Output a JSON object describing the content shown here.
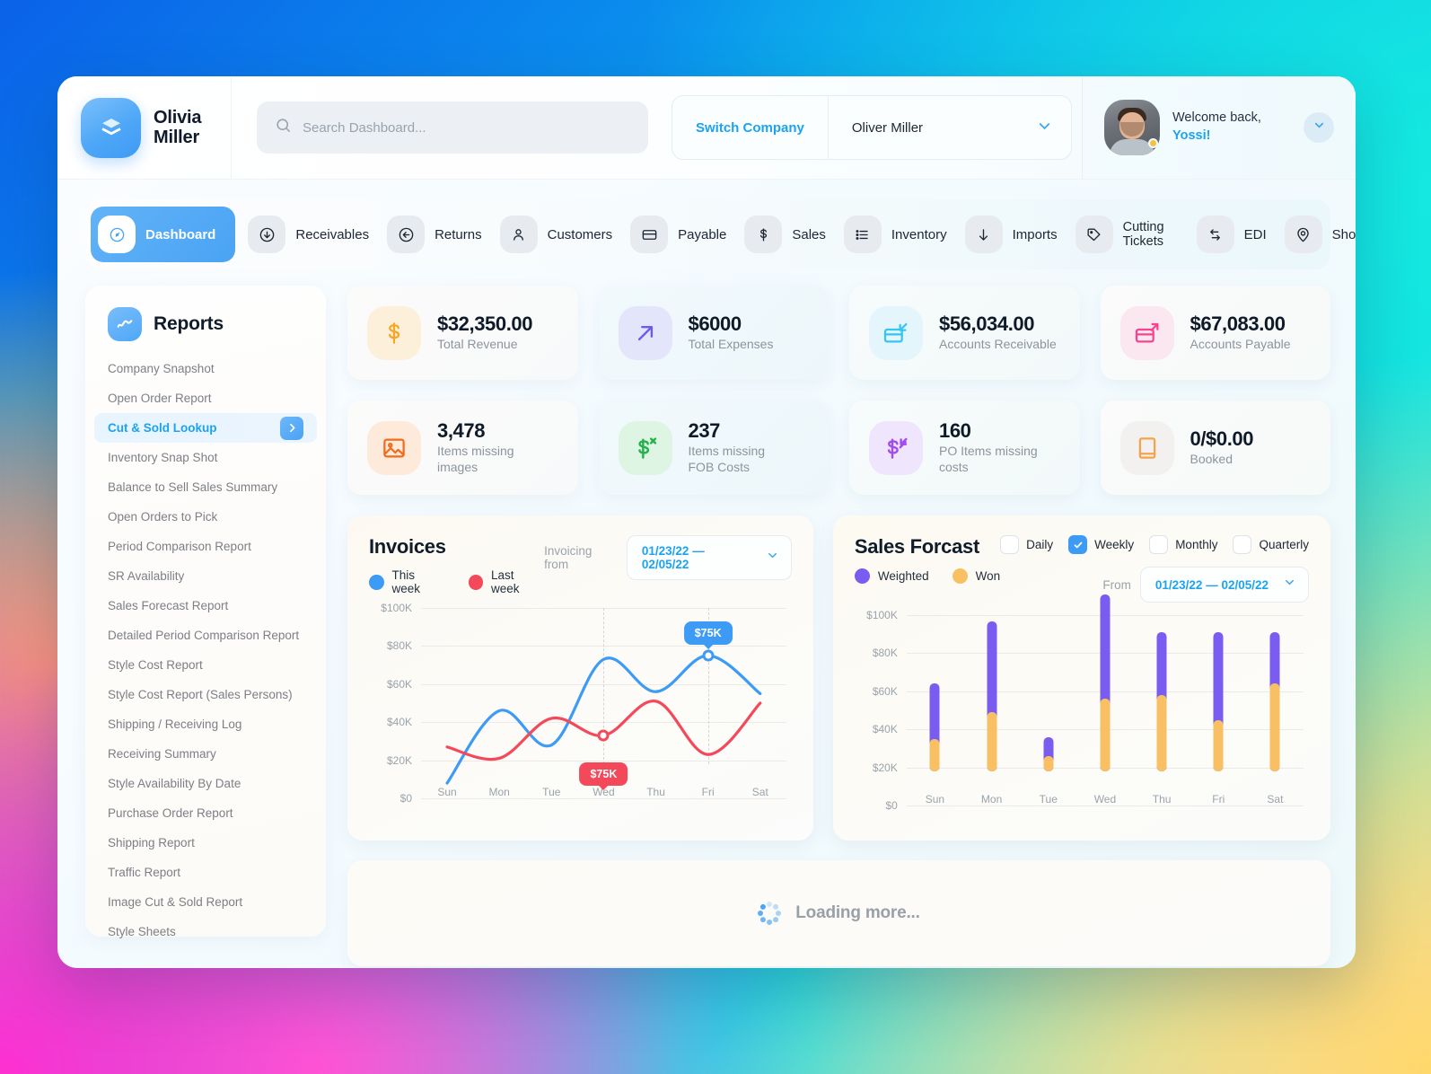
{
  "brand": {
    "name_line1": "Olivia",
    "name_line2": "Miller",
    "logo_icon": "layers-icon"
  },
  "search": {
    "placeholder": "Search Dashboard...",
    "value": "",
    "icon": "search-icon"
  },
  "switcher": {
    "switch_label": "Switch Company",
    "company": "Oliver Miller",
    "caret_icon": "chevron-down-icon"
  },
  "user": {
    "welcome": "Welcome back,",
    "name": "Yossi!",
    "avatar_icon": "avatar",
    "status": "away",
    "caret_icon": "chevron-down-icon"
  },
  "nav": {
    "items": [
      {
        "label": "Dashboard",
        "icon": "gauge-icon",
        "active": true
      },
      {
        "label": "Receivables",
        "icon": "arrow-down-circle-icon",
        "active": false
      },
      {
        "label": "Returns",
        "icon": "arrow-left-circle-icon",
        "active": false
      },
      {
        "label": "Customers",
        "icon": "user-icon",
        "active": false
      },
      {
        "label": "Payable",
        "icon": "card-icon",
        "active": false
      },
      {
        "label": "Sales",
        "icon": "dollar-icon",
        "active": false
      },
      {
        "label": "Inventory",
        "icon": "list-icon",
        "active": false
      },
      {
        "label": "Imports",
        "icon": "arrow-down-icon",
        "active": false
      },
      {
        "label": "Cutting Tickets",
        "icon": "tag-icon",
        "active": false,
        "two_line": true
      },
      {
        "label": "EDI",
        "icon": "transfer-icon",
        "active": false
      },
      {
        "label": "Showroom",
        "icon": "location-pin-icon",
        "active": false
      }
    ]
  },
  "sidebar": {
    "title": "Reports",
    "title_icon": "chart-line-icon",
    "arrow_icon": "chevron-right-icon",
    "items": [
      {
        "label": "Company Snapshot",
        "active": false
      },
      {
        "label": "Open Order Report",
        "active": false
      },
      {
        "label": "Cut & Sold Lookup",
        "active": true
      },
      {
        "label": "Inventory Snap Shot",
        "active": false
      },
      {
        "label": "Balance to Sell Sales Summary",
        "active": false
      },
      {
        "label": "Open Orders to Pick",
        "active": false
      },
      {
        "label": "Period Comparison Report",
        "active": false
      },
      {
        "label": "SR Availability",
        "active": false
      },
      {
        "label": "Sales Forecast Report",
        "active": false
      },
      {
        "label": "Detailed Period Comparison Report",
        "active": false
      },
      {
        "label": "Style Cost Report",
        "active": false
      },
      {
        "label": "Style Cost Report (Sales Persons)",
        "active": false
      },
      {
        "label": "Shipping / Receiving Log",
        "active": false
      },
      {
        "label": "Receiving Summary",
        "active": false
      },
      {
        "label": "Style Availability By Date",
        "active": false
      },
      {
        "label": "Purchase Order Report",
        "active": false
      },
      {
        "label": "Shipping Report",
        "active": false
      },
      {
        "label": "Traffic Report",
        "active": false
      },
      {
        "label": "Image Cut & Sold Report",
        "active": false
      },
      {
        "label": "Style Sheets",
        "active": false
      }
    ]
  },
  "kpis": [
    {
      "value": "$32,350.00",
      "label": "Total Revenue",
      "icon": "dollar-icon",
      "color": "#f5a623",
      "bg": "#fdf0da",
      "tone": "t1"
    },
    {
      "value": "$6000",
      "label": "Total Expenses",
      "icon": "arrow-up-right-icon",
      "color": "#6a5bf2",
      "bg": "#e3e6fb",
      "tone": "t2"
    },
    {
      "value": "$56,034.00",
      "label": "Accounts Receivable",
      "icon": "card-in-icon",
      "color": "#33c5f3",
      "bg": "#e4f6fb",
      "tone": "t3"
    },
    {
      "value": "$67,083.00",
      "label": "Accounts Payable",
      "icon": "card-out-icon",
      "color": "#f7438f",
      "bg": "#fae7ef",
      "tone": "t4"
    },
    {
      "value": "3,478",
      "label": "Items missing\nimages",
      "icon": "image-icon",
      "color": "#f26a1b",
      "bg": "#fdeadb",
      "tone": "t1"
    },
    {
      "value": "237",
      "label": "Items missing\nFOB Costs",
      "icon": "dollar-x-icon",
      "color": "#22b14c",
      "bg": "#ddf5e2",
      "tone": "t2"
    },
    {
      "value": "160",
      "label": "PO Items missing\ncosts",
      "icon": "dollar-transfer-icon",
      "color": "#a14bf0",
      "bg": "#efe5fc",
      "tone": "t3"
    },
    {
      "value": "0/$0.00",
      "label": "Booked",
      "icon": "book-icon",
      "color": "#f5a24a",
      "bg": "#f3f1ef",
      "tone": "t4"
    }
  ],
  "invoices": {
    "title": "Invoices",
    "range_label": "Invoicing from",
    "range_value": "01/23/22 — 02/05/22",
    "caret_icon": "chevron-down-icon",
    "legend": [
      {
        "label": "This week",
        "color": "#3d9bf6"
      },
      {
        "label": "Last week",
        "color": "#f3495b"
      }
    ]
  },
  "forecast": {
    "title": "Sales Forcast",
    "range_label": "From",
    "range_value": "01/23/22 — 02/05/22",
    "caret_icon": "chevron-down-icon",
    "frequencies": [
      {
        "label": "Daily",
        "checked": false
      },
      {
        "label": "Weekly",
        "checked": true
      },
      {
        "label": "Monthly",
        "checked": false
      },
      {
        "label": "Quarterly",
        "checked": false
      }
    ],
    "legend": [
      {
        "label": "Weighted",
        "color": "#7a5cf0"
      },
      {
        "label": "Won",
        "color": "#f8c062"
      }
    ]
  },
  "loading": {
    "text": "Loading more...",
    "icon": "spinner-icon"
  },
  "chart_data": [
    {
      "type": "line",
      "title": "Invoices",
      "xlabel": "",
      "ylabel": "",
      "categories": [
        "Sun",
        "Mon",
        "Tue",
        "Wed",
        "Thu",
        "Fri",
        "Sat"
      ],
      "x_tick_labels": [
        "Sun",
        "Mon",
        "Tue",
        "Wed",
        "Thu",
        "Fri",
        "Sat"
      ],
      "y_tick_labels": [
        "$0",
        "$20K",
        "$40K",
        "$60K",
        "$80K",
        "$100K"
      ],
      "ylim": [
        0,
        100
      ],
      "y_unit": "K",
      "grid": true,
      "legend_position": "top-left",
      "series": [
        {
          "name": "This week",
          "color": "#3d9bf6",
          "values": [
            8,
            46,
            28,
            73,
            56,
            75,
            55
          ]
        },
        {
          "name": "Last week",
          "color": "#f3495b",
          "values": [
            27,
            21,
            42,
            33,
            51,
            23,
            50
          ]
        }
      ],
      "annotations": [
        {
          "series": "This week",
          "category": "Fri",
          "value": 75,
          "label": "$75K",
          "color": "#3d9bf6"
        },
        {
          "series": "Last week",
          "category": "Wed",
          "value": 33,
          "label": "$75K",
          "color": "#f3495b"
        }
      ]
    },
    {
      "type": "bar",
      "title": "Sales Forcast",
      "xlabel": "",
      "ylabel": "",
      "stacked": true,
      "categories": [
        "Sun",
        "Mon",
        "Tue",
        "Wed",
        "Thu",
        "Fri",
        "Sat"
      ],
      "x_tick_labels": [
        "Sun",
        "Mon",
        "Tue",
        "Wed",
        "Thu",
        "Fri",
        "Sat"
      ],
      "y_tick_labels": [
        "$0",
        "$20K",
        "$40K",
        "$60K",
        "$80K",
        "$100K"
      ],
      "ylim": [
        0,
        100
      ],
      "y_unit": "K",
      "grid": true,
      "legend_position": "top-left",
      "series": [
        {
          "name": "Won",
          "color": "#f8c062",
          "values": [
            17,
            31,
            8,
            38,
            40,
            27,
            46
          ]
        },
        {
          "name": "Weighted",
          "color": "#7a5cf0",
          "totals": [
            46,
            79,
            18,
            93,
            73,
            73,
            73
          ]
        }
      ]
    }
  ]
}
